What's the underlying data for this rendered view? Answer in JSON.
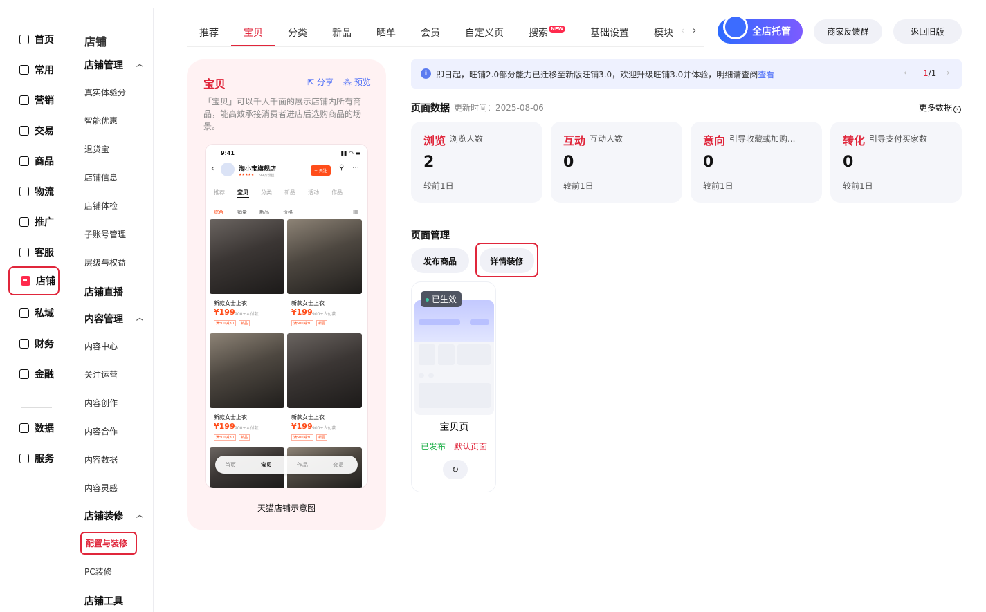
{
  "main_nav": [
    {
      "label": "首页",
      "icon": "home-icon"
    },
    {
      "label": "常用",
      "icon": "common-icon"
    },
    {
      "label": "营销",
      "icon": "marketing-icon"
    },
    {
      "label": "交易",
      "icon": "trade-icon"
    },
    {
      "label": "商品",
      "icon": "goods-icon"
    },
    {
      "label": "物流",
      "icon": "logistics-icon"
    },
    {
      "label": "推广",
      "icon": "promote-icon"
    },
    {
      "label": "客服",
      "icon": "service-icon"
    },
    {
      "label": "店铺",
      "icon": "store-icon"
    },
    {
      "label": "私域",
      "icon": "private-domain-icon"
    },
    {
      "label": "财务",
      "icon": "finance-icon"
    },
    {
      "label": "金融",
      "icon": "fintech-icon"
    },
    {
      "label": "数据",
      "icon": "data-icon"
    },
    {
      "label": "服务",
      "icon": "services-icon"
    }
  ],
  "sub_nav": {
    "title": "店铺",
    "store_mgmt": "店铺管理",
    "store_mgmt_items": [
      "真实体验分",
      "智能优惠",
      "退货宝",
      "店铺信息",
      "店铺体检",
      "子账号管理",
      "层级与权益"
    ],
    "live": "店铺直播",
    "content_mgmt": "内容管理",
    "content_items": [
      "内容中心",
      "关注运营",
      "内容创作",
      "内容合作",
      "内容数据",
      "内容灵感"
    ],
    "decoration": "店铺装修",
    "decoration_items": [
      "配置与装修",
      "PC装修"
    ],
    "tools": "店铺工具"
  },
  "tabs": [
    "推荐",
    "宝贝",
    "分类",
    "新品",
    "晒单",
    "会员",
    "自定义页",
    "搜索",
    "基础设置",
    "模块"
  ],
  "new_badge": "NEW",
  "top_buttons": {
    "ai": "全店托管",
    "feedback": "商家反馈群",
    "old": "返回旧版"
  },
  "preview": {
    "title": "宝贝",
    "share": "分享",
    "preview": "预览",
    "desc": "「宝贝」可以千人千面的展示店铺内所有商品，能高效承接消费者进店后选购商品的场景。",
    "caption": "天猫店铺示意图",
    "phone": {
      "time": "9:41",
      "shop": "淘小宝旗舰店",
      "fans": "99万粉丝",
      "follow": "+ 关注",
      "tabs": [
        "推荐",
        "宝贝",
        "分类",
        "新品",
        "活动",
        "作品"
      ],
      "sort": [
        "综合",
        "销量",
        "新品",
        "价格"
      ],
      "products": [
        {
          "name": "新款女士上衣",
          "price": "199",
          "sold": "900+人付款",
          "tag1": "满500减30",
          "tag2": "新品"
        },
        {
          "name": "新款女士上衣",
          "price": "199",
          "sold": "900+人付款",
          "tag1": "满500减30",
          "tag2": "新品"
        },
        {
          "name": "新款女士上衣",
          "price": "199",
          "sold": "900+人付款",
          "tag1": "满500减30",
          "tag2": "新品"
        },
        {
          "name": "新款女士上衣",
          "price": "199",
          "sold": "900+人付款",
          "tag1": "满500减30",
          "tag2": "新品"
        }
      ],
      "bottom_tabs": [
        "首页",
        "宝贝",
        "作品",
        "会员"
      ]
    }
  },
  "notice": {
    "text": "即日起，旺铺2.0部分能力已迁移至新版旺铺3.0，欢迎升级旺铺3.0并体验，明细请查阅",
    "link": "查看",
    "page_current": "1",
    "page_total": "/1"
  },
  "page_data": {
    "title": "页面数据",
    "updated": "更新时间：2025-08-06",
    "more": "更多数据",
    "stats": [
      {
        "key": "浏览",
        "desc": "浏览人数",
        "value": "2",
        "compare": "较前1日",
        "delta": "—"
      },
      {
        "key": "互动",
        "desc": "互动人数",
        "value": "0",
        "compare": "较前1日",
        "delta": "—"
      },
      {
        "key": "意向",
        "desc": "引导收藏或加购...",
        "value": "0",
        "compare": "较前1日",
        "delta": "—"
      },
      {
        "key": "转化",
        "desc": "引导支付买家数",
        "value": "0",
        "compare": "较前1日",
        "delta": "—"
      }
    ]
  },
  "page_mgmt": {
    "title": "页面管理",
    "publish": "发布商品",
    "detail": "详情装修",
    "card": {
      "badge": "已生效",
      "name": "宝贝页",
      "status": "已发布",
      "default": "默认页面"
    }
  },
  "colors": {
    "accent": "#e0263b",
    "link": "#4a6cf7",
    "published": "#22b14c"
  }
}
